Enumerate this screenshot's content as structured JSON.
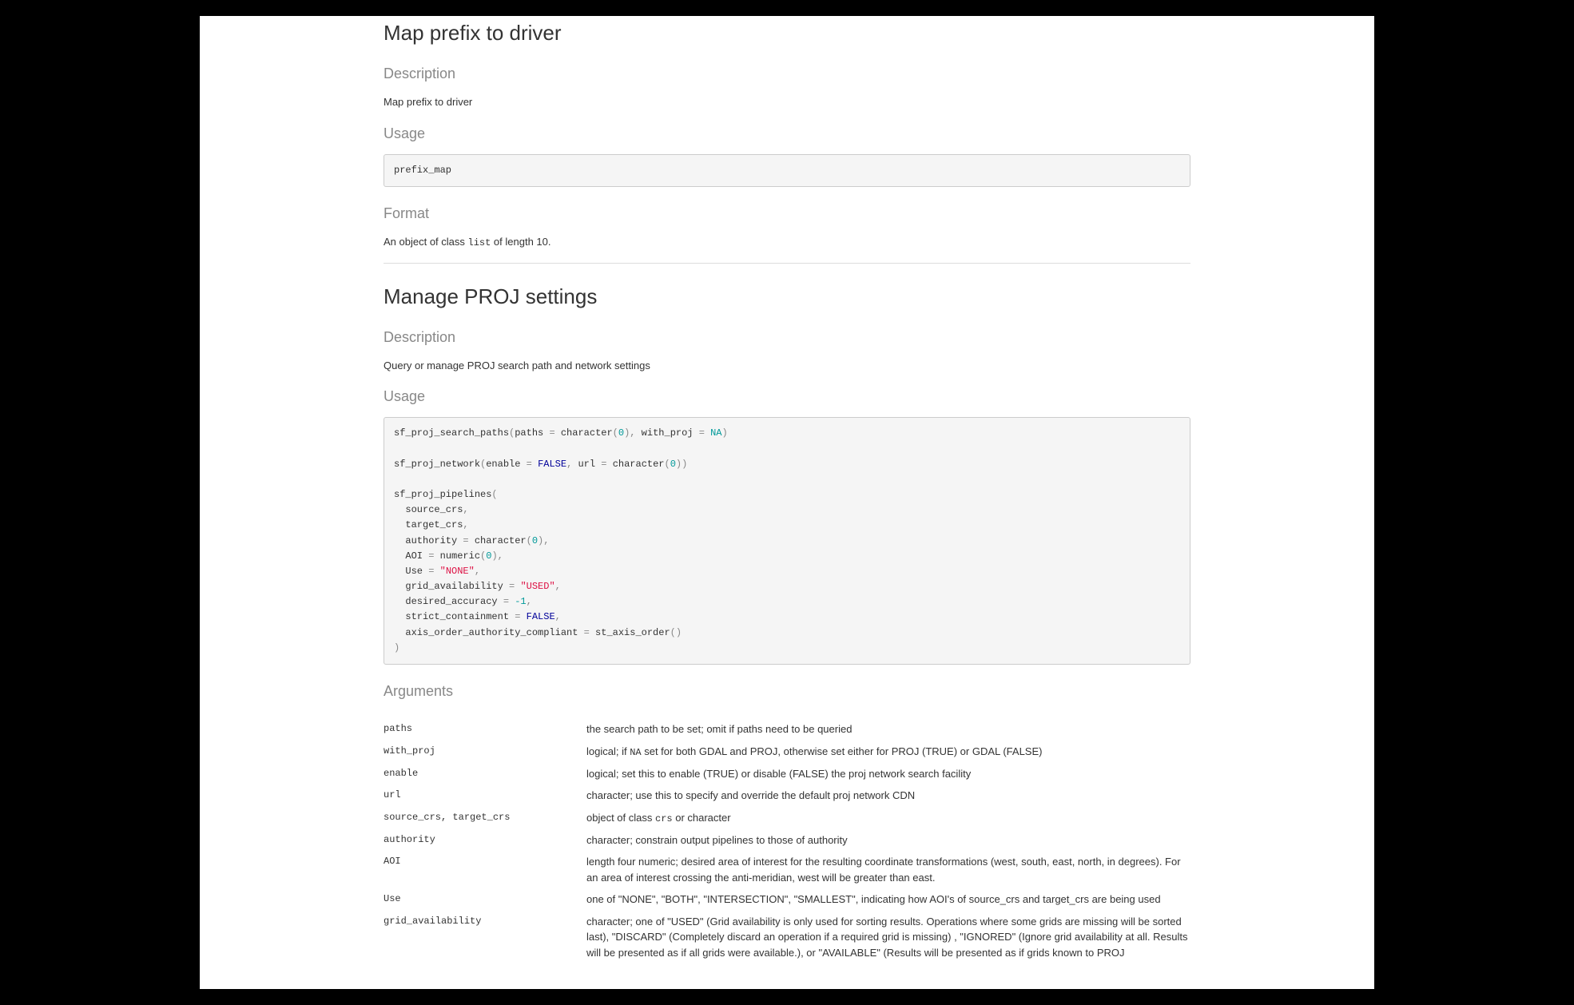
{
  "section1": {
    "title": "Map prefix to driver",
    "desc_head": "Description",
    "desc_body": "Map prefix to driver",
    "usage_head": "Usage",
    "usage_code": "prefix_map",
    "format_head": "Format",
    "format_pre": "An object of class ",
    "format_code": "list",
    "format_post": " of length 10."
  },
  "section2": {
    "title": "Manage PROJ settings",
    "desc_head": "Description",
    "desc_body": "Query or manage PROJ search path and network settings",
    "usage_head": "Usage",
    "args_head": "Arguments",
    "code": {
      "fn1": "sf_proj_search_paths",
      "fn1_arg1": "paths ",
      "fn1_eq": "=",
      "fn1_char": " character",
      "fn1_zero": "0",
      "fn1_comma": ",",
      "fn1_arg2": " with_proj ",
      "fn1_na": "NA",
      "fn2": "sf_proj_network",
      "fn2_arg1": "enable ",
      "fn2_false": "FALSE",
      "fn2_url": " url ",
      "fn3": "sf_proj_pipelines",
      "fn3_src": "  source_crs",
      "fn3_tgt": "  target_crs",
      "fn3_auth": "  authority ",
      "fn3_aoi": "  AOI ",
      "fn3_numeric": " numeric",
      "fn3_use": "  Use ",
      "fn3_none": "\"NONE\"",
      "fn3_grid": "  grid_availability ",
      "fn3_used": "\"USED\"",
      "fn3_des": "  desired_accuracy ",
      "fn3_neg1": "-1",
      "fn3_strict": "  strict_containment ",
      "fn3_axis": "  axis_order_authority_compliant ",
      "fn3_stax": " st_axis_order"
    },
    "args": [
      {
        "name": "paths",
        "desc": "the search path to be set; omit if paths need to be queried"
      },
      {
        "name": "with_proj",
        "desc_pre": "logical; if ",
        "desc_code": "NA",
        "desc_post": " set for both GDAL and PROJ, otherwise set either for PROJ (TRUE) or GDAL (FALSE)"
      },
      {
        "name": "enable",
        "desc": "logical; set this to enable (TRUE) or disable (FALSE) the proj network search facility"
      },
      {
        "name": "url",
        "desc": "character; use this to specify and override the default proj network CDN"
      },
      {
        "name": "source_crs, target_crs",
        "desc_pre": "object of class ",
        "desc_code": "crs",
        "desc_post": " or character"
      },
      {
        "name": "authority",
        "desc": "character; constrain output pipelines to those of authority"
      },
      {
        "name": "AOI",
        "desc": "length four numeric; desired area of interest for the resulting coordinate transformations (west, south, east, north, in degrees). For an area of interest crossing the anti-meridian, west will be greater than east."
      },
      {
        "name": "Use",
        "desc": "one of \"NONE\", \"BOTH\", \"INTERSECTION\", \"SMALLEST\", indicating how AOI's of source_crs and target_crs are being used"
      },
      {
        "name": "grid_availability",
        "desc": "character; one of \"USED\" (Grid availability is only used for sorting results. Operations where some grids are missing will be sorted last), \"DISCARD\" (Completely discard an operation if a required grid is missing) , \"IGNORED\" (Ignore grid availability at all. Results will be presented as if all grids were available.), or \"AVAILABLE\" (Results will be presented as if grids known to PROJ"
      }
    ]
  }
}
